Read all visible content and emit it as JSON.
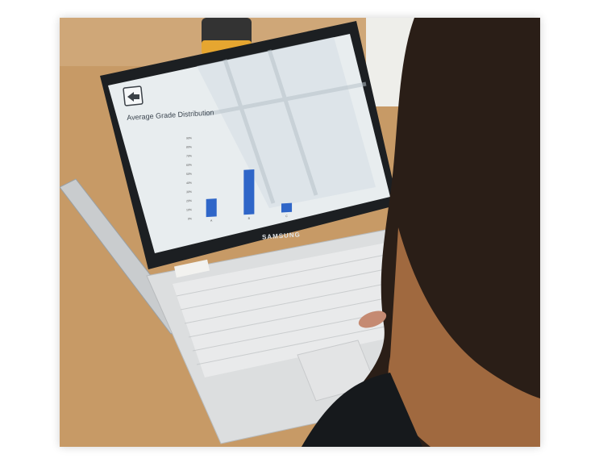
{
  "photo": {
    "description_colors": {
      "desk": "#c99a63",
      "screen": "#e9eef0",
      "bar": "#2f66c8",
      "hair_dark": "#2a1e17",
      "hair_light": "#b97a45"
    }
  },
  "screen": {
    "title": "Average Grade Distribution",
    "back_icon": "arrow-left-icon"
  },
  "laptop": {
    "brand": "SAMSUNG"
  },
  "chart_data": {
    "type": "bar",
    "title": "Average Grade Distribution",
    "categories": [
      "A",
      "B",
      "C"
    ],
    "values": [
      20,
      50,
      10
    ],
    "yticks": [
      "0%",
      "10%",
      "20%",
      "30%",
      "40%",
      "50%",
      "60%",
      "70%",
      "80%",
      "90%"
    ],
    "ylim": [
      0,
      90
    ],
    "color": "#2f66c8",
    "grid": false
  }
}
